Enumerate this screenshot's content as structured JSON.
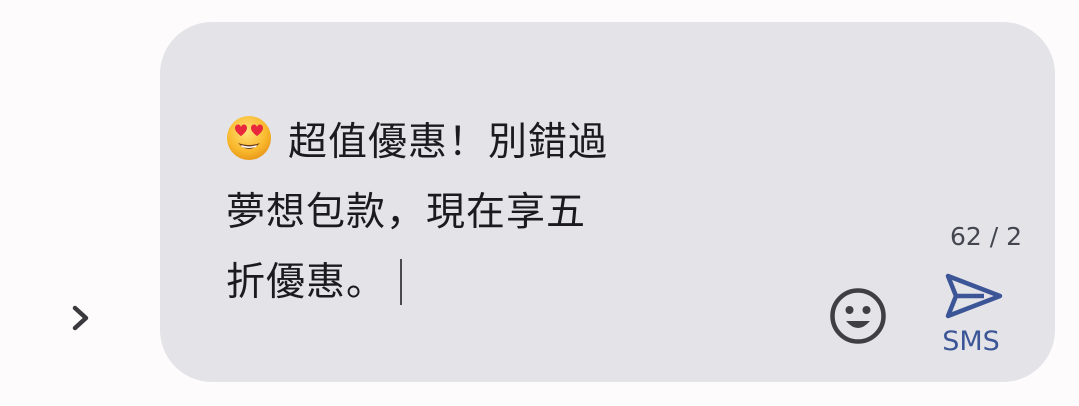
{
  "composer": {
    "emoji_name": "smiling-face-with-heart-eyes",
    "message_line_1": "超值優惠！別錯過",
    "message_line_2": "夢想包款，現在享五",
    "message_line_3": "折優惠。",
    "char_counter": "62 / 2",
    "send_label": "SMS",
    "send_color": "#3c5597",
    "bubble_color": "#e3e3e8"
  },
  "icons": {
    "expand": "chevron-right-icon",
    "emoji_picker": "smiley-face-icon",
    "send": "send-arrow-icon"
  }
}
